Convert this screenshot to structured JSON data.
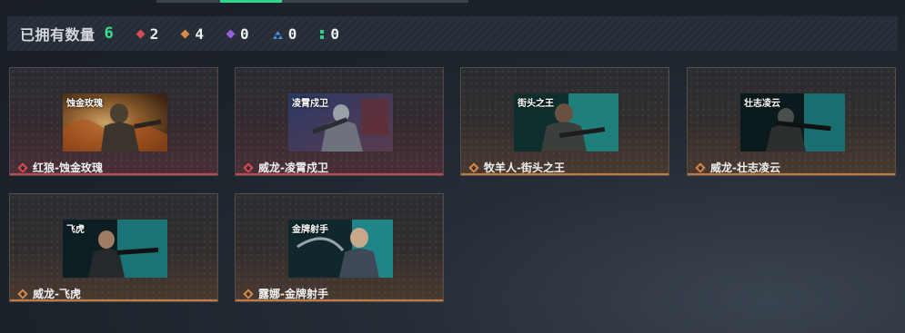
{
  "summary": {
    "label": "已拥有数量",
    "total": "6",
    "rarities": [
      {
        "icon": "red-diamond-icon",
        "color": "#d94a57",
        "count": "2"
      },
      {
        "icon": "orange-diamond-icon",
        "color": "#d98a47",
        "count": "4"
      },
      {
        "icon": "purple-diamond-icon",
        "color": "#9a5ee0",
        "count": "0"
      },
      {
        "icon": "blue-triangle-icon",
        "color": "#4a8fe0",
        "count": "0"
      },
      {
        "icon": "green-dots-icon",
        "color": "#37c88a",
        "count": "0"
      }
    ]
  },
  "cards": [
    {
      "name": "红狼-蚀金玫瑰",
      "rarity": "red",
      "gem_color": "#d94a57",
      "thumb_title": "蚀金玫瑰"
    },
    {
      "name": "威龙-凌霄戍卫",
      "rarity": "red",
      "gem_color": "#d94a57",
      "thumb_title": "凌霄戍卫"
    },
    {
      "name": "牧羊人-街头之王",
      "rarity": "orange",
      "gem_color": "#d98a47",
      "thumb_title": "街头之王"
    },
    {
      "name": "威龙-壮志凌云",
      "rarity": "orange",
      "gem_color": "#d98a47",
      "thumb_title": "壮志凌云"
    },
    {
      "name": "威龙-飞虎",
      "rarity": "orange",
      "gem_color": "#d98a47",
      "thumb_title": "飞虎"
    },
    {
      "name": "露娜-金牌射手",
      "rarity": "orange",
      "gem_color": "#d98a47",
      "thumb_title": "金牌射手"
    }
  ]
}
